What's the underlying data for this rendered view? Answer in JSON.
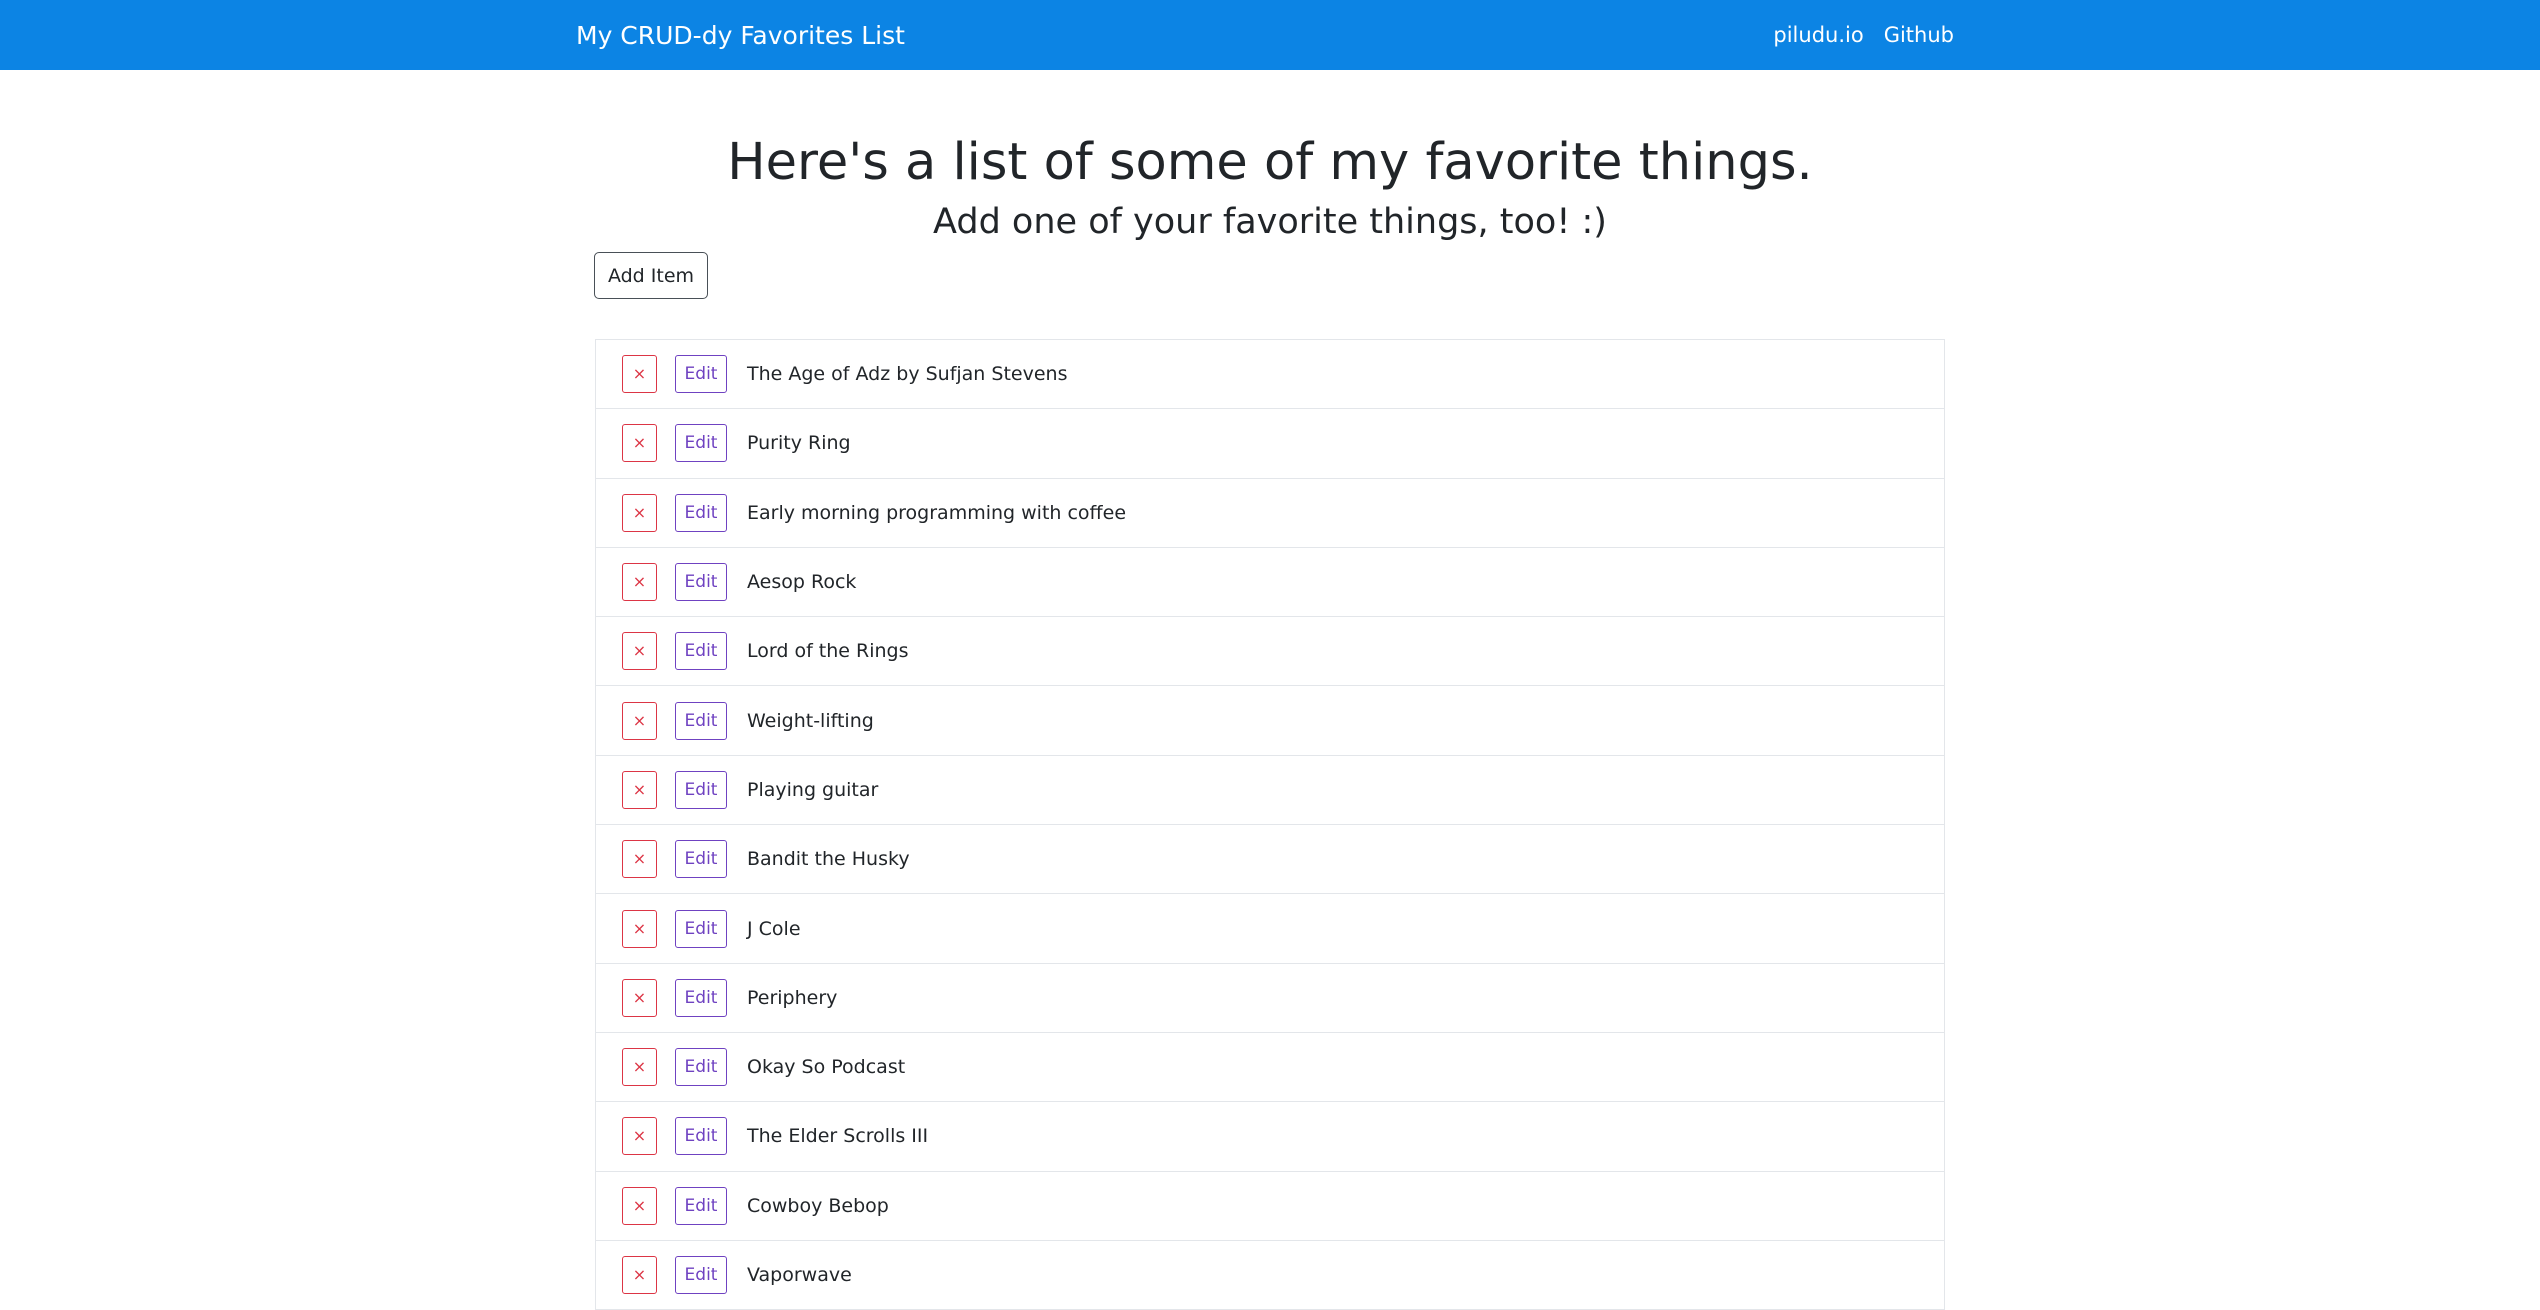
{
  "navbar": {
    "brand": "My CRUD-dy Favorites List",
    "links": [
      "piludu.io",
      "Github"
    ]
  },
  "hero": {
    "title": "Here's a list of some of my favorite things.",
    "subtitle": "Add one of your favorite things, too! :)"
  },
  "add_button_label": "Add Item",
  "row_buttons": {
    "delete_label": "×",
    "edit_label": "Edit"
  },
  "items": [
    "The Age of Adz by Sufjan Stevens",
    "Purity Ring",
    "Early morning programming with coffee",
    "Aesop Rock",
    "Lord of the Rings",
    "Weight-lifting",
    "Playing guitar",
    "Bandit the Husky",
    "J Cole",
    "Periphery",
    "Okay So Podcast",
    "The Elder Scrolls III",
    "Cowboy Bebop",
    "Vaporwave"
  ],
  "colors": {
    "navbar": "#0c84e4",
    "delete": "#dc3545",
    "edit": "#6f42c1",
    "border": "#e3e6ea"
  }
}
